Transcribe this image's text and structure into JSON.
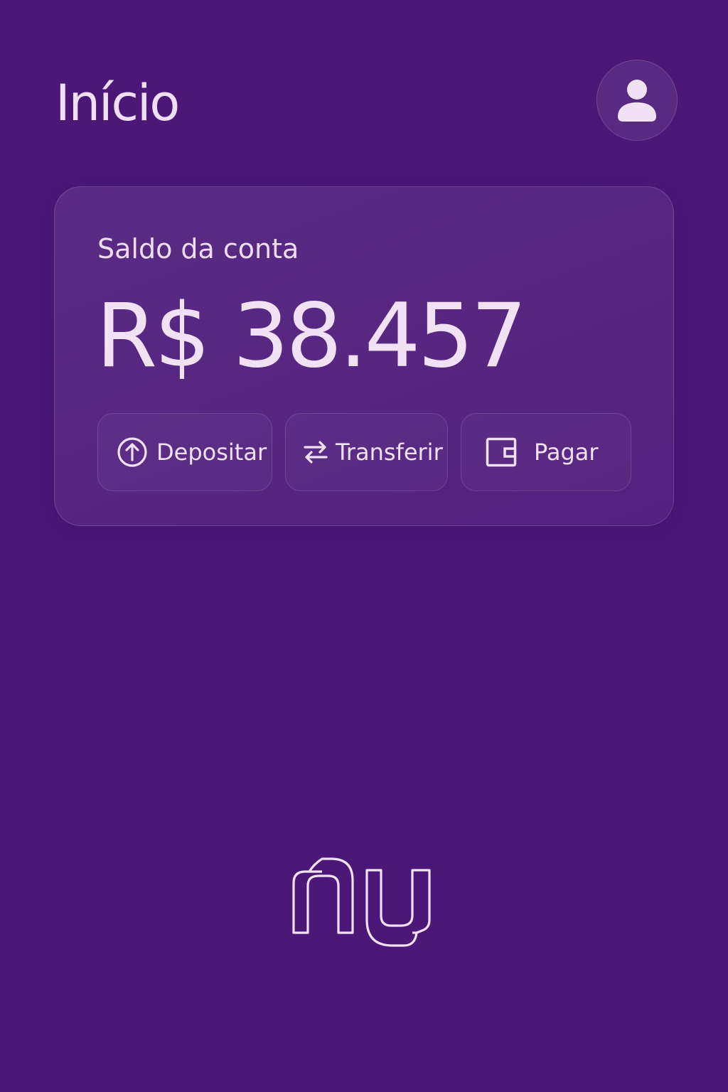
{
  "header": {
    "title": "Início",
    "profile_icon": "user-icon"
  },
  "balance_card": {
    "label": "Saldo da conta",
    "amount": "R$ 38.457"
  },
  "actions": [
    {
      "label": "Depositar",
      "icon": "arrow-up-circle-icon"
    },
    {
      "label": "Transferir",
      "icon": "transfer-arrows-icon"
    },
    {
      "label": "Pagar",
      "icon": "wallet-icon"
    }
  ],
  "brand": {
    "logo": "nu",
    "background": "#4B1878",
    "text_color": "#EEDCF2"
  }
}
